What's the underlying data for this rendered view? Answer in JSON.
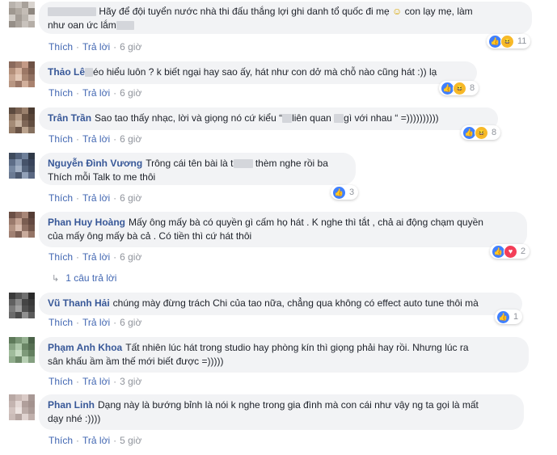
{
  "actions": {
    "like": "Thích",
    "reply": "Trả lời"
  },
  "comments": [
    {
      "name": "",
      "text_a": "Hãy để đội tuyển nước nhà thi đấu thắng lợi ghi danh tổ quốc đi mẹ",
      "emoji": "☺",
      "text_b": "con lạy mẹ, làm",
      "text_c": "như oan ức lắm",
      "time": "6 giờ",
      "react_count": "11"
    },
    {
      "name": "Thảo Lê",
      "text_a": "éo hiểu luôn ? k biết ngại hay sao ấy, hát như con dở mà chỗ nào cũng hát :)) lạ",
      "time": "6 giờ",
      "react_count": "8"
    },
    {
      "name": "Trân Trần",
      "text_a": "Sao tao thấy nhạc, lời và giọng nó cứ kiểu “",
      "text_b": "liên quan",
      "text_c": "gì với nhau “ =))))))))))",
      "time": "6 giờ",
      "react_count": "8"
    },
    {
      "name": "Nguyễn Đình Vương",
      "text_a": "Trông cái tên bài là t",
      "text_b": "thèm nghe rồi ba",
      "text_c": "Thích mỗi Talk to me thôi",
      "time": "6 giờ",
      "react_count": "3"
    },
    {
      "name": "Phan Huy Hoàng",
      "text_a": "Mấy ông mấy bà có quyền gì cấm họ hát . K nghe thì tắt , chả ai động chạm quyền",
      "text_b": "của mấy ông mấy bà cả . Có tiền thì cứ hát thôi",
      "time": "6 giờ",
      "react_count": "2"
    },
    {
      "name": "Vũ Thanh Hải",
      "text_a": "chúng mày đừng trách Chi của tao nữa, chẳng qua không có effect auto tune thôi mà",
      "time": "6 giờ",
      "react_count": "1"
    },
    {
      "name": "Phạm Anh Khoa",
      "text_a": "Tất nhiên lúc hát trong studio hay phòng kín thì giọng phải hay rồi. Nhưng lúc ra",
      "text_b": "sân khấu ầm ầm thế mới biết được =)))))",
      "time": "3 giờ"
    },
    {
      "name": "Phan Linh",
      "text_a": "Dạng này là bướng bỉnh là nói k nghe trong gia đình mà con cái như vậy ng ta gọi là mất",
      "text_b": "dạy nhé :))))",
      "time": "5 giờ"
    }
  ],
  "replies_link": "1 câu trả lời",
  "colors": {
    "name": "#385898",
    "link": "#4267b2",
    "bubble": "#f2f3f5",
    "meta": "#90949c",
    "like": "#4080ff",
    "haha": "#f7b928",
    "love": "#f33e58"
  },
  "icons": [
    "like-icon",
    "haha-icon",
    "love-icon",
    "smile-emoji-icon",
    "reply-arrow-icon"
  ]
}
